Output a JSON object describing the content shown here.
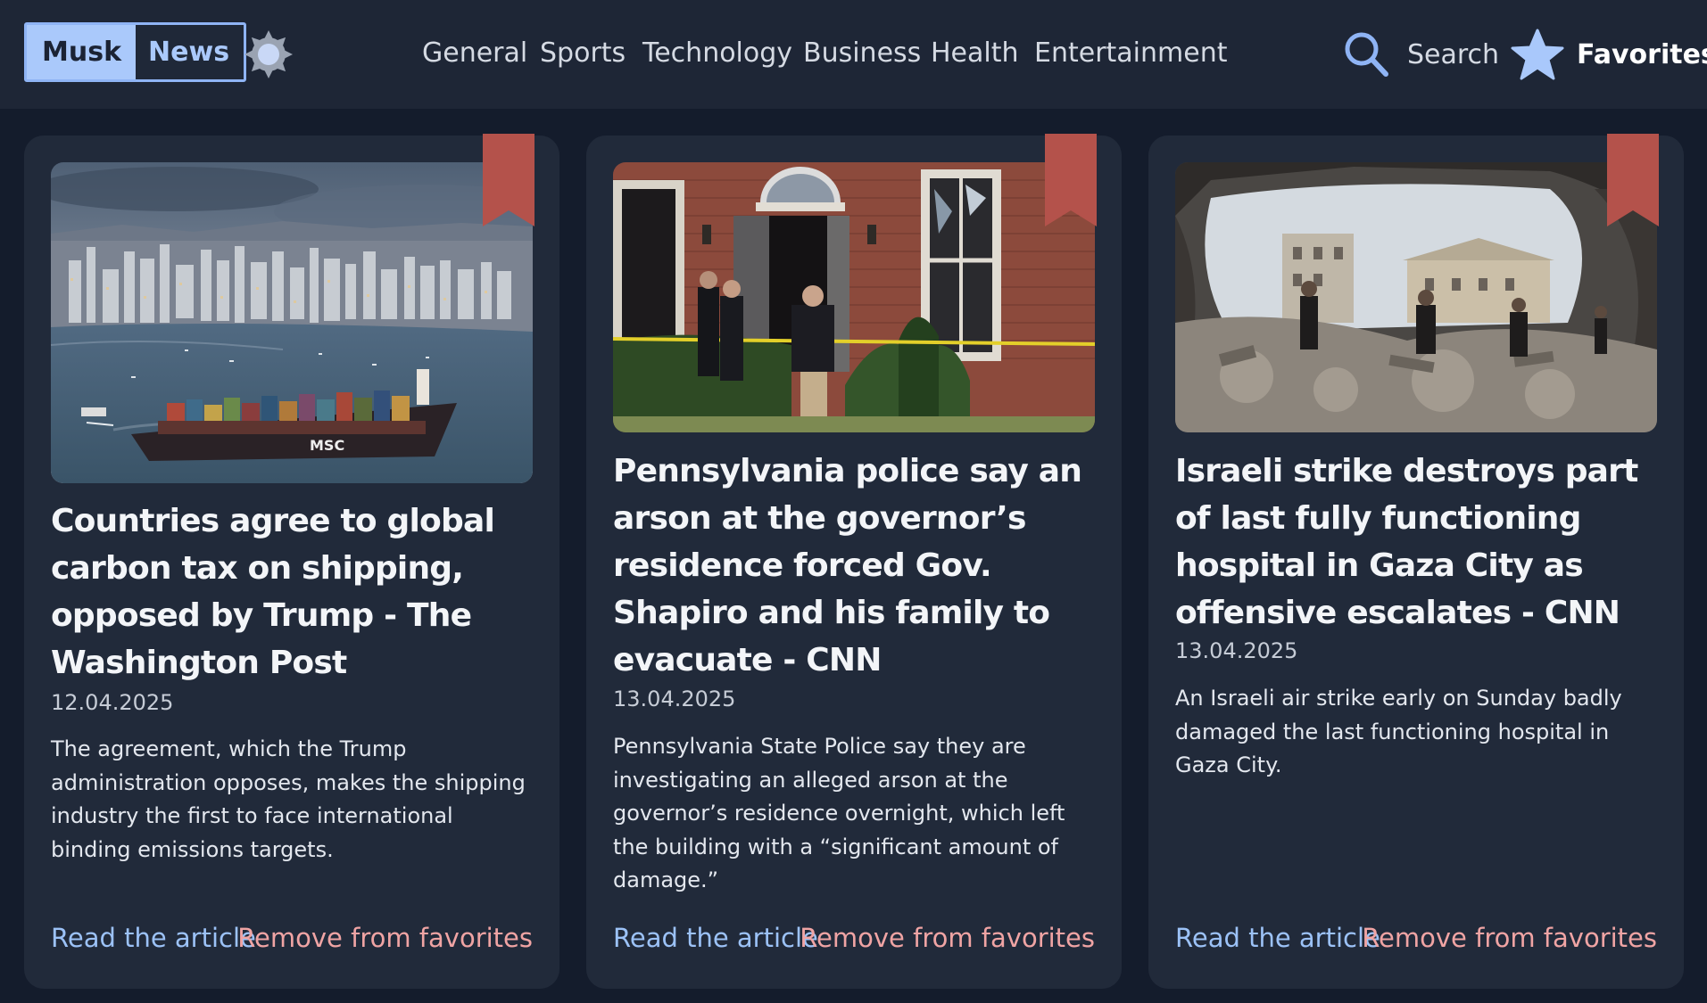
{
  "brand": {
    "part1": "Musk",
    "part2": "News"
  },
  "nav": {
    "items": [
      {
        "label": "General"
      },
      {
        "label": "Sports"
      },
      {
        "label": "Technology"
      },
      {
        "label": "Business"
      },
      {
        "label": "Health"
      },
      {
        "label": "Entertainment"
      }
    ],
    "search_label": "Search",
    "favorites_label": "Favorites"
  },
  "icons": {
    "theme": "sun-icon",
    "search": "search-icon",
    "favorites": "star-icon",
    "bookmark": "bookmark-icon"
  },
  "colors": {
    "background": "#141c2c",
    "header": "#1e2636",
    "card": "#212a3a",
    "accent": "#aac9fb",
    "link": "#9cc2f7",
    "remove": "#f0a4a4",
    "bookmark": "#b4524b"
  },
  "articles": [
    {
      "title": "Countries agree to global carbon tax on shipping, opposed by Trump - The Washington Post",
      "date": "12.04.2025",
      "description": "The agreement, which the Trump administration opposes, makes the shipping industry the first to face international binding emissions targets.",
      "image_text": "MSC",
      "read_label": "Read the article",
      "remove_label": "Remove from favorites"
    },
    {
      "title": "Pennsylvania police say an arson at the governor’s residence forced Gov. Shapiro and his family to evacuate - CNN",
      "date": "13.04.2025",
      "description": "Pennsylvania State Police say they are investigating an alleged arson at the governor’s residence overnight, which left the building with a “significant amount of damage.”",
      "read_label": "Read the article",
      "remove_label": "Remove from favorites"
    },
    {
      "title": "Israeli strike destroys part of last fully functioning hospital in Gaza City as offensive escalates - CNN",
      "date": "13.04.2025",
      "description": "An Israeli air strike early on Sunday badly damaged the last functioning hospital in Gaza City.",
      "read_label": "Read the article",
      "remove_label": "Remove from favorites"
    }
  ]
}
